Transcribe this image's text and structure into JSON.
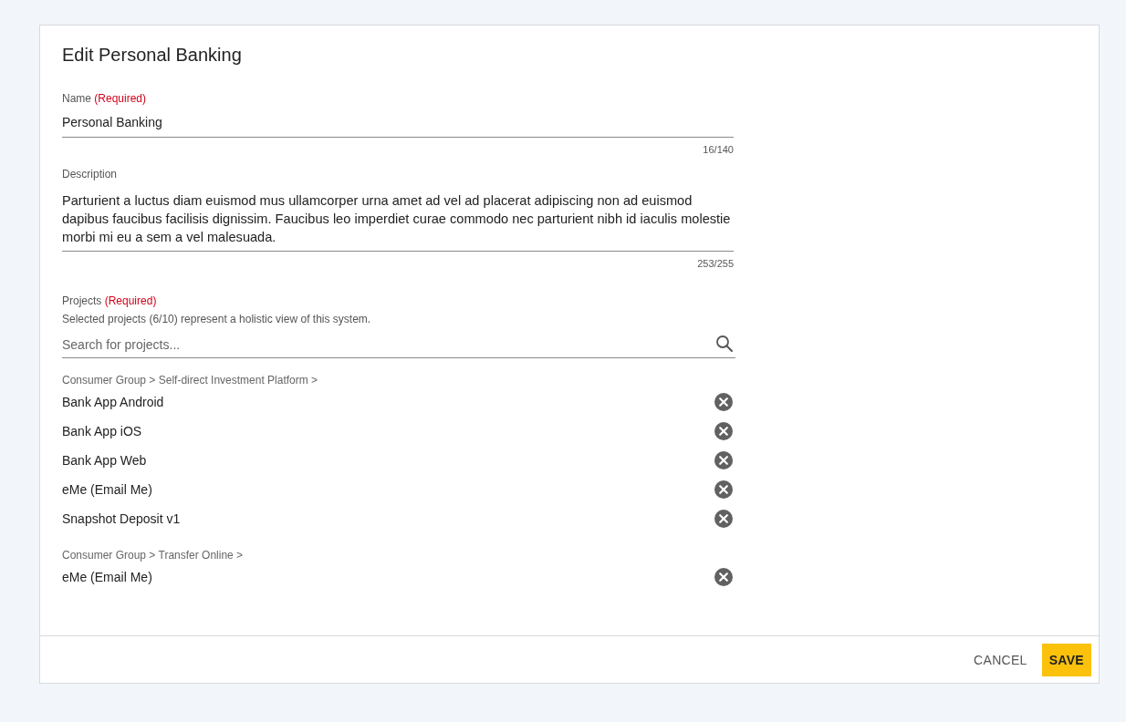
{
  "dialog": {
    "title": "Edit Personal Banking"
  },
  "name_field": {
    "label": "Name",
    "required_note": "(Required)",
    "value": "Personal Banking",
    "counter": "16/140"
  },
  "description_field": {
    "label": "Description",
    "value": "Parturient a luctus diam euismod mus ullamcorper urna amet ad vel ad placerat adipiscing non ad euismod dapibus faucibus facilisis dignissim. Faucibus leo imperdiet curae commodo nec parturient nibh id iaculis molestie morbi mi eu a sem a vel malesuada.",
    "counter": "253/255"
  },
  "projects": {
    "label": "Projects",
    "required_note": "(Required)",
    "hint": "Selected projects (6/10) represent a holistic view of this system.",
    "search": {
      "placeholder": "Search for projects..."
    },
    "groups": [
      {
        "path": "Consumer Group > Self-direct Investment Platform >",
        "items": [
          "Bank App Android",
          "Bank App iOS",
          "Bank App Web",
          "eMe (Email Me)",
          "Snapshot Deposit v1"
        ]
      },
      {
        "path": "Consumer Group > Transfer Online >",
        "items": [
          "eMe (Email Me)"
        ]
      }
    ]
  },
  "buttons": {
    "cancel": "CANCEL",
    "save": "SAVE"
  }
}
